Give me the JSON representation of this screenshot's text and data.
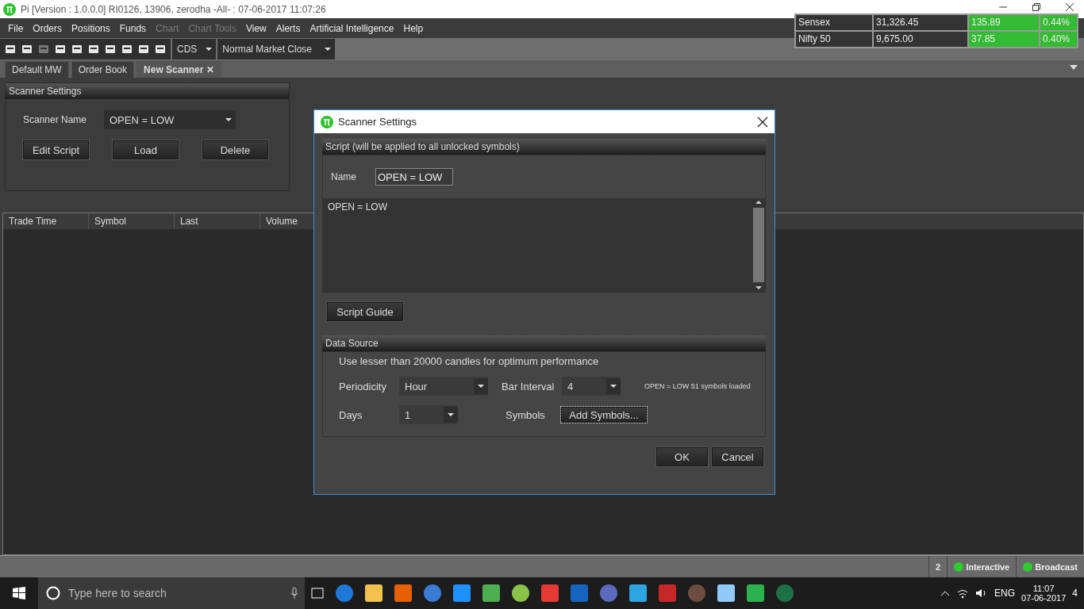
{
  "window": {
    "title": "Pi [Version : 1.0.0.0] RI0126, 13906, zerodha -All- : 07-06-2017 11:07:26"
  },
  "menu": [
    {
      "label": "File",
      "disabled": false
    },
    {
      "label": "Orders",
      "disabled": false
    },
    {
      "label": "Positions",
      "disabled": false
    },
    {
      "label": "Funds",
      "disabled": false
    },
    {
      "label": "Chart",
      "disabled": true
    },
    {
      "label": "Chart Tools",
      "disabled": true
    },
    {
      "label": "View",
      "disabled": false
    },
    {
      "label": "Alerts",
      "disabled": false
    },
    {
      "label": "Artificial Intelligence",
      "disabled": false
    },
    {
      "label": "Help",
      "disabled": false
    }
  ],
  "toolbar": {
    "exchange": "CDS",
    "market_status": "Normal Market Close"
  },
  "tabs": [
    {
      "label": "Default MW",
      "selected": false
    },
    {
      "label": "Order Book",
      "selected": false
    },
    {
      "label": "New Scanner",
      "selected": true,
      "close": "✕"
    }
  ],
  "indices": [
    {
      "name": "Sensex",
      "value": "31,326.45",
      "change": "135.89",
      "percent": "0.44%"
    },
    {
      "name": "Nifty 50",
      "value": "9,675.00",
      "change": "37.85",
      "percent": "0.40%"
    }
  ],
  "scanner_panel": {
    "title": "Scanner Settings",
    "name_label": "Scanner Name",
    "name_value": "OPEN = LOW",
    "buttons": [
      "Edit Script",
      "Load",
      "Delete"
    ]
  },
  "table": {
    "columns": [
      "Trade Time",
      "Symbol",
      "Last",
      "Volume"
    ]
  },
  "dialog": {
    "title": "Scanner Settings",
    "script_section": "Script (will be applied to all unlocked symbols)",
    "name_label": "Name",
    "name_value": "OPEN = LOW",
    "script_text": "OPEN = LOW",
    "script_guide": "Script Guide",
    "data_section": "Data Source",
    "hint": "Use lesser than 20000 candles for optimum performance",
    "periodicity_label": "Periodicity",
    "periodicity": "Hour",
    "bar_interval_label": "Bar Interval",
    "bar_interval": "4",
    "status": "OPEN = LOW  51 symbols loaded",
    "days_label": "Days",
    "days": "1",
    "symbols_label": "Symbols",
    "add_symbols": "Add Symbols...",
    "buttons": [
      "OK",
      "Cancel"
    ]
  },
  "status_bar": {
    "count": "2",
    "connections": [
      {
        "label": "Interactive",
        "on": true
      },
      {
        "label": "Broadcast",
        "on": true
      }
    ]
  },
  "taskbar": {
    "search_placeholder": "Type here to search",
    "language": "ENG",
    "time": "11:07",
    "date": "07-06-2017",
    "notifications": "4"
  }
}
